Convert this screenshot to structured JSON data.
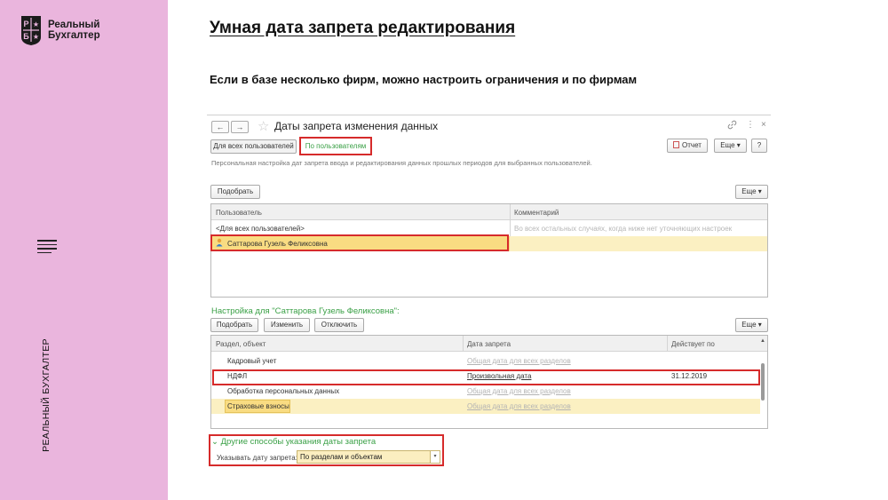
{
  "brand": {
    "logo_letters": [
      "Р",
      "Б"
    ],
    "name_line1": "Реальный",
    "name_line2": "Бухгалтер",
    "vertical_label": "РЕАЛЬНЫЙ БУХГАЛТЕР",
    "colors": {
      "sidebar": "#eab5dd",
      "text": "#1b1b1b"
    }
  },
  "slide": {
    "title": "Умная дата запрета редактирования",
    "subtitle": "Если в базе несколько фирм, можно настроить ограничения и по фирмам"
  },
  "window": {
    "title": "Даты запрета изменения данных",
    "back_icon": "←",
    "forward_icon": "→",
    "star_icon": "☆",
    "link_icon": "🔗",
    "more_icon": "⋮",
    "close_icon": "×",
    "tabs": [
      "Для всех пользователей",
      "По пользователям"
    ],
    "report_button": "Отчет",
    "more_button": "Еще",
    "help_button": "?",
    "hint": "Персональная настройка дат запрета ввода и редактирования данных прошлых периодов для выбранных пользователей.",
    "pick_button": "Подобрать",
    "users_table": {
      "columns": [
        "Пользователь",
        "Комментарий"
      ],
      "rows": [
        {
          "user": "<Для всех пользователей>",
          "comment": "Во всех остальных случаях, когда ниже нет уточняющих настроек"
        },
        {
          "user": "Саттарова Гузель Феликсовна",
          "comment": ""
        }
      ]
    },
    "settings_title": "Настройка для \"Саттарова Гузель Феликсовна\":",
    "settings_buttons": {
      "pick": "Подобрать",
      "edit": "Изменить",
      "disable": "Отключить",
      "more": "Еще"
    },
    "sections_table": {
      "columns": [
        "Раздел, объект",
        "Дата запрета",
        "Действует по"
      ],
      "rows": [
        {
          "section": "Кадровый учет",
          "date": "Общая дата для всех разделов",
          "valid": ""
        },
        {
          "section": "НДФЛ",
          "date": "Произвольная дата",
          "valid": "31.12.2019"
        },
        {
          "section": "Обработка персональных данных",
          "date": "Общая дата для всех разделов",
          "valid": ""
        },
        {
          "section": "Страховые взносы",
          "date": "Общая дата для всех разделов",
          "valid": ""
        }
      ]
    },
    "other_ways": {
      "title": "Другие способы указания даты запрета",
      "field_label": "Указывать дату запрета:",
      "field_value": "По разделам и объектам"
    },
    "colors": {
      "highlight_row": "#fbf0c2",
      "selected_cell": "#f9dc82",
      "accent_green": "#3aa046",
      "red_frame": "#d62b2b"
    }
  }
}
